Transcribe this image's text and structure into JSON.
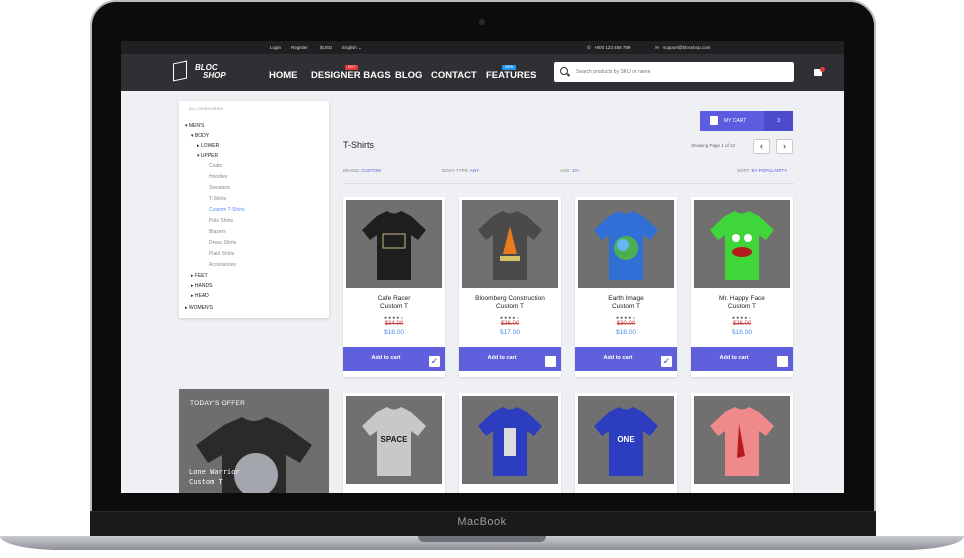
{
  "device": {
    "brand": "MacBook"
  },
  "topbar": {
    "login": "Login",
    "register": "Register",
    "currency": "$USD",
    "language": "English ⌄",
    "phone": "+800 123 456 789",
    "email": "support@blocshop.com"
  },
  "nav": {
    "logo_line1": "BLOC",
    "logo_line2": "SHOP",
    "items": [
      "HOME",
      "DESIGNER BAGS",
      "BLOG",
      "CONTACT",
      "FEATURES"
    ],
    "badge_bags": "HOT",
    "badge_features": "NEW",
    "badge_bags_color": "#e53935",
    "badge_features_color": "#2196f3"
  },
  "search": {
    "placeholder": "Search products by SKU or name"
  },
  "sidebar": {
    "heading": "ALL CATEGORIES",
    "mens": "▾ MEN'S",
    "body": "▾ BODY",
    "lower": "▸ LOWER",
    "upper": "▾ UPPER",
    "upper_items": [
      "Coats",
      "Hoodies",
      "Sweaters",
      "T-Shirts",
      "Custom T-Shirts",
      "Polo Shirts",
      "Blazers",
      "Dress Shirts",
      "Plaid Shirts",
      "Accessories"
    ],
    "feet": "▸ FEET",
    "hands": "▸ HANDS",
    "head": "▸ HEAD",
    "womens": "▸ WOMEN'S"
  },
  "offer": {
    "title": "TODAY'S OFFER",
    "name_line1": "Lone Warrior",
    "name_line2": "Custom T"
  },
  "cart_button": {
    "label": "MY CART",
    "count": "3"
  },
  "listing": {
    "title": "T-Shirts",
    "showing": "Showing Page 1 of 12",
    "prev": "‹",
    "next": "›"
  },
  "filters": {
    "brand_label": "BRAND:",
    "brand_value": "CUSTOM",
    "body_label": "BODY TYPE:",
    "body_value": "ANY",
    "age_label": "AGE:",
    "age_value": "10+",
    "sort_label": "SORT:",
    "sort_value": "BY POPULARITY"
  },
  "products": [
    {
      "name1": "Cafe Racer",
      "name2": "Custom T",
      "stars": "★★★★☆",
      "old": "$34.00",
      "price": "$18.00",
      "add": "Add to cart",
      "checked": true,
      "shirt": "#1e1e1e"
    },
    {
      "name1": "Bloomberg Construction",
      "name2": "Custom T",
      "stars": "★★★★☆",
      "old": "$26.00",
      "price": "$17.00",
      "add": "Add to cart",
      "checked": false,
      "shirt": "#4a4a4a"
    },
    {
      "name1": "Earth Image",
      "name2": "Custom T",
      "stars": "★★★★☆",
      "old": "$30.00",
      "price": "$18.00",
      "add": "Add to cart",
      "checked": true,
      "shirt": "#2f6fd6"
    },
    {
      "name1": "Mr. Happy Face",
      "name2": "Custom T",
      "stars": "★★★★☆",
      "old": "$26.00",
      "price": "$16.00",
      "add": "Add to cart",
      "checked": false,
      "shirt": "#3fd63a"
    }
  ],
  "products_row2": [
    {
      "shirt": "#c8c8c8",
      "print": "SPACE"
    },
    {
      "shirt": "#2d3dc0",
      "print": ""
    },
    {
      "shirt": "#2d3dc0",
      "print": "ONE"
    },
    {
      "shirt": "#f08a8a",
      "print": ""
    }
  ],
  "colors": {
    "accent": "#5c5ce0",
    "navbar": "#2f3033",
    "price": "#4a8de0",
    "old_price": "#c94040"
  }
}
